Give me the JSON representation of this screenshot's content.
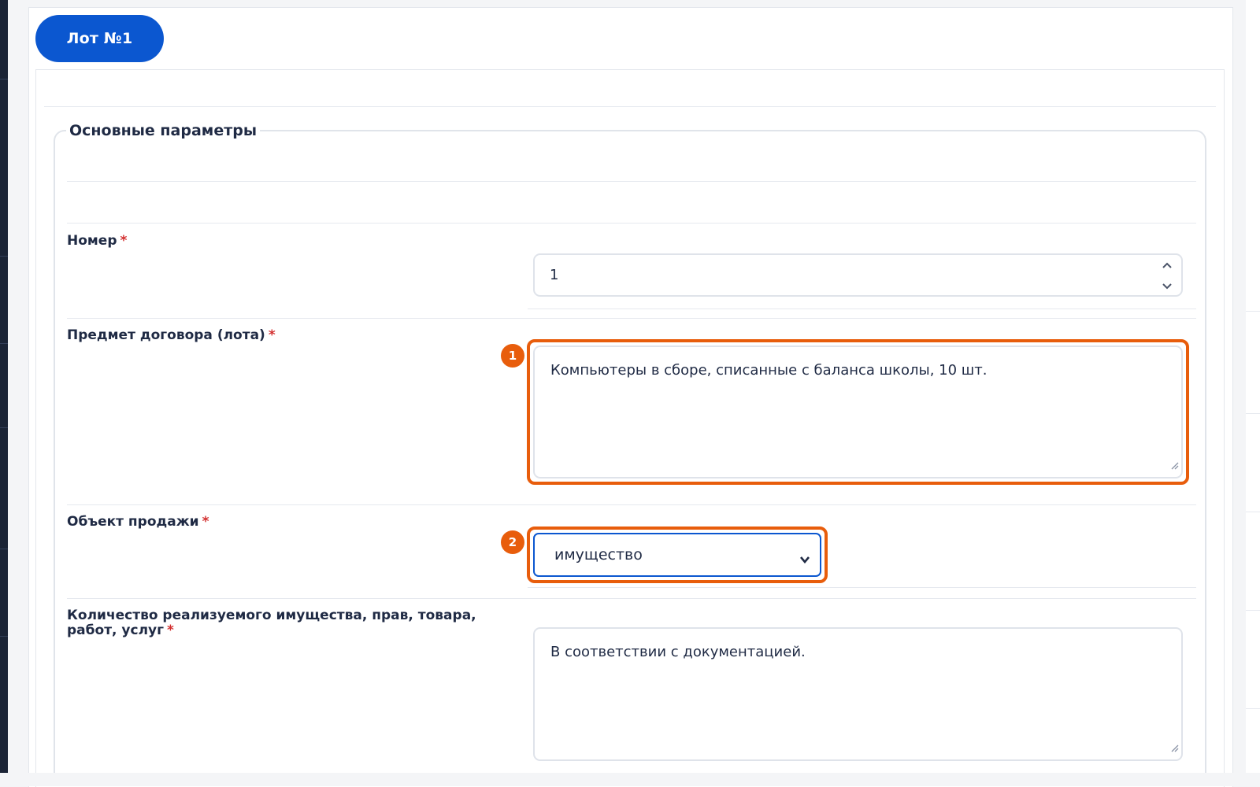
{
  "lot": {
    "tab_label": "Лот №1"
  },
  "section": {
    "title": "Основные параметры"
  },
  "fields": {
    "number": {
      "label": "Номер",
      "required_mark": "*",
      "value": "1"
    },
    "subject": {
      "label": "Предмет договора (лота)",
      "required_mark": "*",
      "value": "Компьютеры в сборе, списанные с баланса школы, 10 шт.",
      "badge": "1"
    },
    "sale_object": {
      "label": "Объект продажи",
      "required_mark": "*",
      "selected": "имущество",
      "badge": "2"
    },
    "quantity": {
      "label_line1": "Количество реализуемого имущества, прав, товара,",
      "label_line2": "работ, услуг",
      "required_mark": "*",
      "value": "В соответствии с документацией."
    }
  },
  "colors": {
    "primary": "#0b57d0",
    "highlight": "#e85d0c",
    "required": "#d32f2f",
    "text": "#1f2a44"
  },
  "icons": {
    "spin_up": "chevron-up-icon",
    "spin_down": "chevron-down-icon",
    "select": "chevron-down-icon",
    "resize": "resize-grip-icon"
  }
}
